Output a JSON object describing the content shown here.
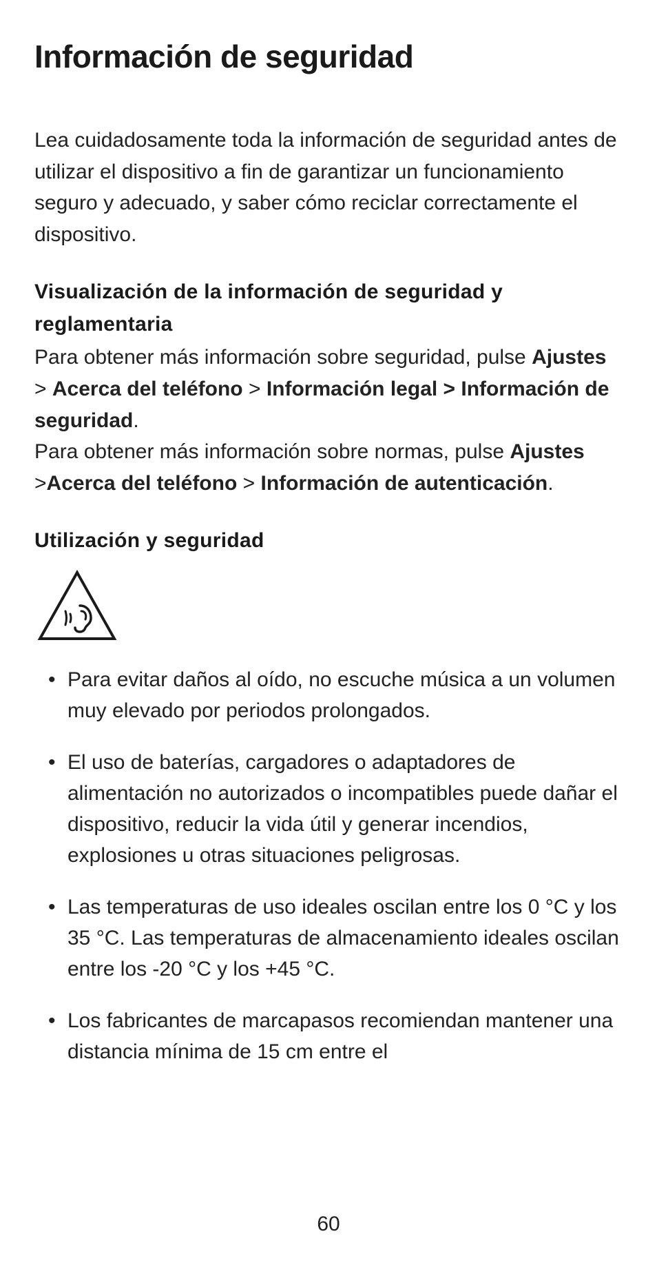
{
  "title": "Información de seguridad",
  "intro": "Lea cuidadosamente toda la información de seguridad antes de utilizar el dispositivo a fin de garantizar un funcionamiento seguro y adecuado, y saber cómo reciclar correctamente el dispositivo.",
  "section1": {
    "heading": "Visualización de la información de seguridad y reglamentaria",
    "p1_pre": "Para obtener más información sobre seguridad, pulse ",
    "p1_b1": "Ajustes",
    "p1_gt1": " > ",
    "p1_b2": "Acerca del teléfono",
    "p1_gt2": " > ",
    "p1_b3": "Información legal > Información de seguridad",
    "p1_post": ".",
    "p2_pre": "Para obtener más información sobre normas, pulse ",
    "p2_b1": "Ajustes",
    "p2_gt1": " >",
    "p2_b2": "Acerca del teléfono",
    "p2_gt2": " > ",
    "p2_b3": "Información de autenticación",
    "p2_post": "."
  },
  "section2": {
    "heading": "Utilización y seguridad",
    "bullets": [
      "Para evitar daños al oído, no escuche música a un volumen muy elevado por periodos prolongados.",
      "El uso de baterías, cargadores o adaptadores de alimentación no autorizados o incompatibles puede dañar el dispositivo, reducir la vida útil y generar incendios, explosiones u otras situaciones peligrosas.",
      "Las temperaturas de uso ideales oscilan entre los 0 °C y los 35 °C. Las temperaturas de almacenamiento ideales oscilan entre los -20 °C y los +45 °C.",
      "Los fabricantes de marcapasos recomiendan mantener una distancia mínima de 15 cm entre el"
    ]
  },
  "page_number": "60"
}
